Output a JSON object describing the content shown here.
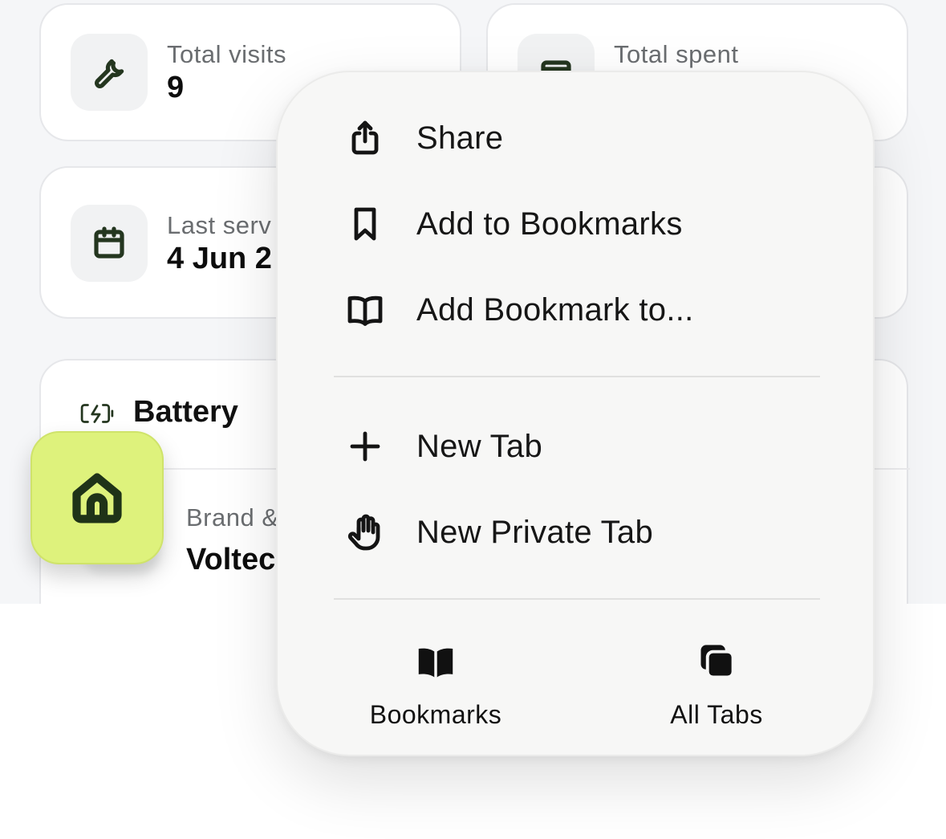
{
  "app": {
    "accent_color": "#def27c",
    "icon_color": "#24361f"
  },
  "cards": {
    "total_visits": {
      "label": "Total visits",
      "value": "9",
      "icon": "wrench-icon"
    },
    "total_spent": {
      "label": "Total spent",
      "icon": "wallet-icon"
    },
    "last_service": {
      "label": "Last serv",
      "value": "4 Jun 2",
      "icon": "calendar-icon"
    }
  },
  "battery": {
    "title": "Battery",
    "icon": "battery-charging-icon",
    "brand_label": "Brand &",
    "brand_value": "Voltec"
  },
  "fab": {
    "icon": "home-icon"
  },
  "menu": {
    "items": [
      {
        "label": "Share",
        "icon": "share-icon"
      },
      {
        "label": "Add to Bookmarks",
        "icon": "bookmark-icon"
      },
      {
        "label": "Add Bookmark to...",
        "icon": "book-open-icon"
      },
      {
        "label": "New Tab",
        "icon": "plus-icon"
      },
      {
        "label": "New Private Tab",
        "icon": "hand-icon"
      }
    ],
    "bottom": [
      {
        "label": "Bookmarks",
        "icon": "book-filled-icon"
      },
      {
        "label": "All Tabs",
        "icon": "tabs-icon"
      }
    ]
  }
}
